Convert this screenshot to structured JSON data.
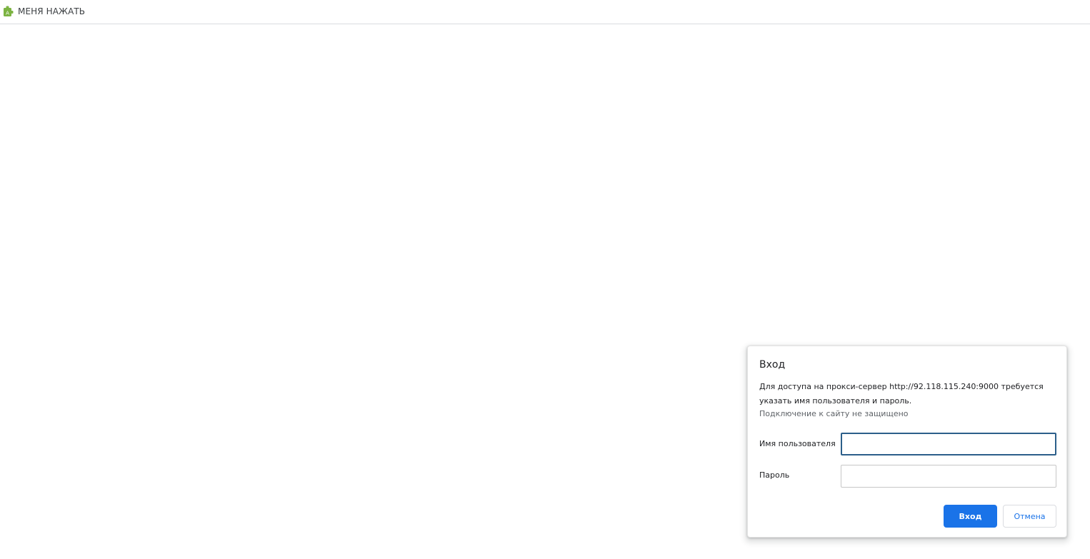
{
  "toolbar": {
    "extension_label": "МЕНЯ НАЖАТЬ",
    "extension_icon": "extension-puzzle-icon",
    "extension_icon_letter": "A",
    "extension_icon_color": "#7cb342"
  },
  "dialog": {
    "title": "Вход",
    "message": "Для доступа на прокси-сервер http://92.118.115.240:9000 требуется указать имя пользователя и пароль.",
    "warning": "Подключение к сайту не защищено",
    "username_label": "Имя пользователя",
    "username_value": "",
    "password_label": "Пароль",
    "password_value": "",
    "submit_label": "Вход",
    "cancel_label": "Отмена"
  },
  "colors": {
    "accent": "#1a73e8",
    "focus_border": "#2c5f8a"
  }
}
